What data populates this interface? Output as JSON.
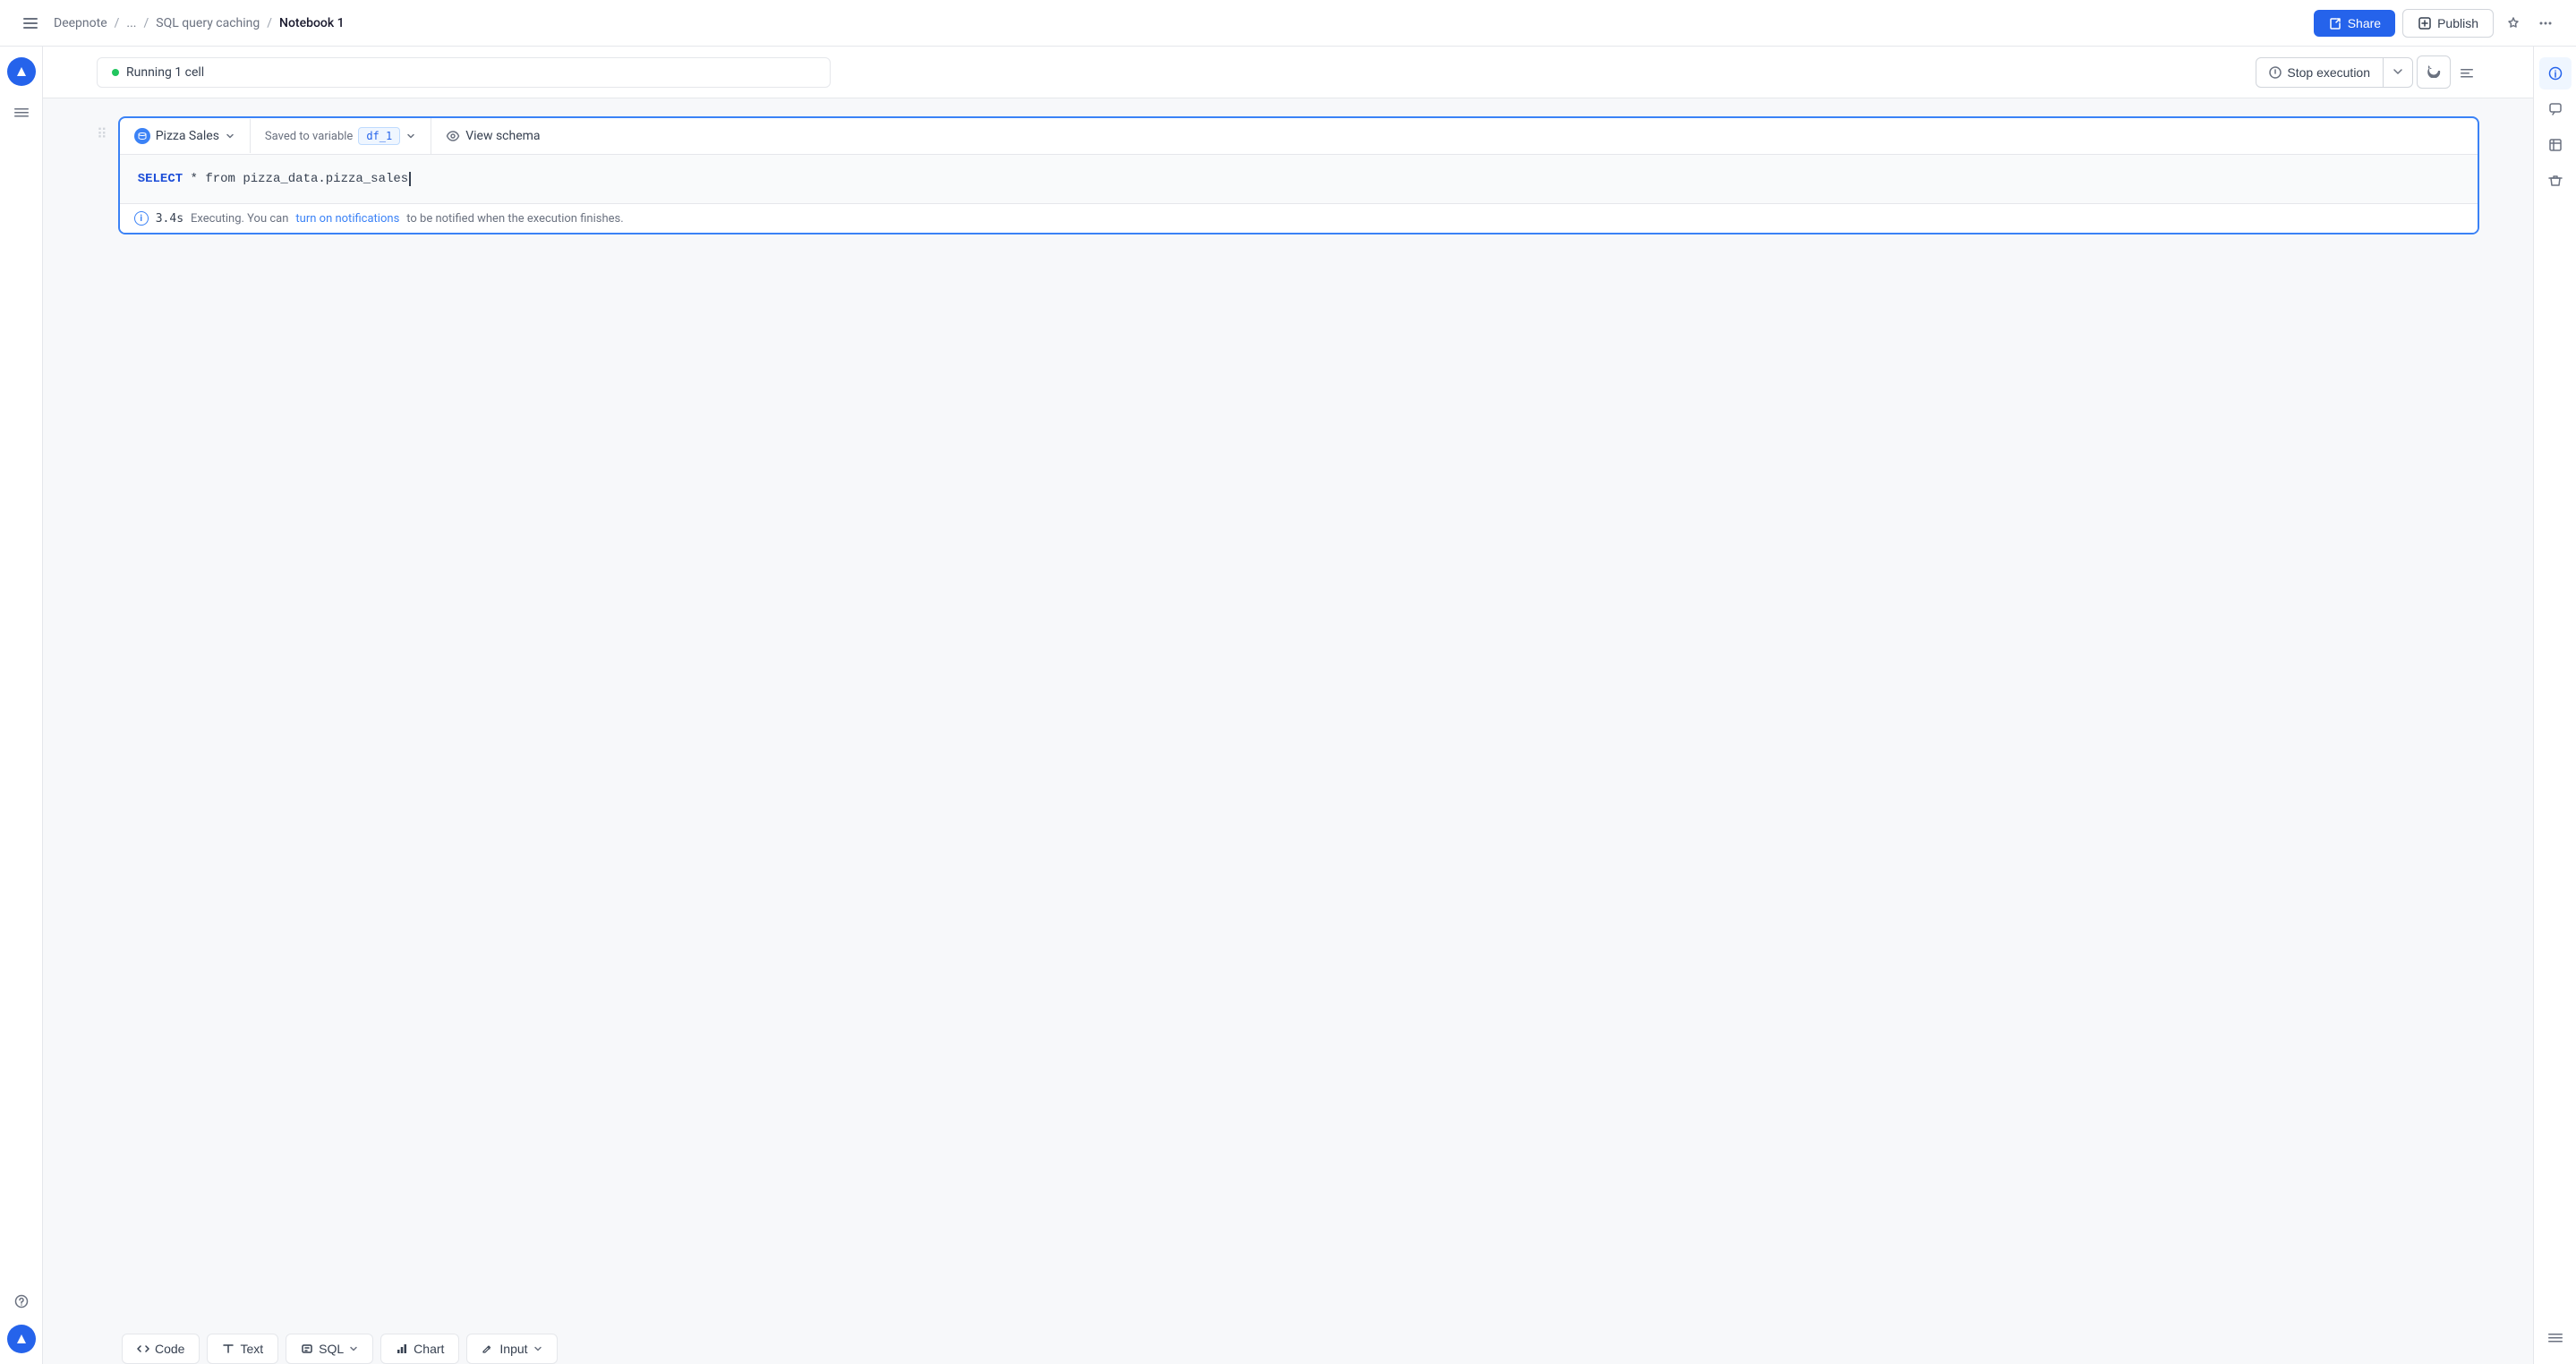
{
  "header": {
    "breadcrumb": {
      "root": "Deepnote",
      "separator1": "/",
      "ellipsis": "...",
      "separator2": "/",
      "section": "SQL query caching",
      "separator3": "/",
      "current": "Notebook 1"
    },
    "share_label": "Share",
    "publish_label": "Publish",
    "more_label": "..."
  },
  "status_bar": {
    "running_text": "Running 1 cell",
    "stop_label": "Stop execution",
    "indicator_color": "#22c55e"
  },
  "cell": {
    "db_name": "Pizza Sales",
    "saved_to_label": "Saved to variable",
    "variable_name": "df_1",
    "view_schema_label": "View schema",
    "code_line": "SELECT * from pizza_data.pizza_sales",
    "code_keyword": "SELECT",
    "code_rest": " * from pizza_data.pizza_sales",
    "exec_time": "3.4s",
    "exec_message": " Executing. You can ",
    "notifications_link": "turn on notifications",
    "exec_suffix": " to be notified when the execution finishes."
  },
  "add_cell_buttons": [
    {
      "id": "code",
      "label": "Code",
      "icon": "<>"
    },
    {
      "id": "text",
      "label": "Text",
      "icon": "Tt"
    },
    {
      "id": "sql",
      "label": "SQL",
      "icon": "sql"
    },
    {
      "id": "chart",
      "label": "Chart",
      "icon": "chart"
    },
    {
      "id": "input",
      "label": "Input",
      "icon": "pencil"
    }
  ],
  "icons": {
    "menu": "☰",
    "help": "?",
    "star": "☆",
    "database": "⊙",
    "table_icon": "⊞",
    "trash": "🗑",
    "lines": "≡",
    "share_arrow": "↗",
    "eye": "◉",
    "chevron_down": "▾",
    "rotate": "↻",
    "info": "i"
  }
}
